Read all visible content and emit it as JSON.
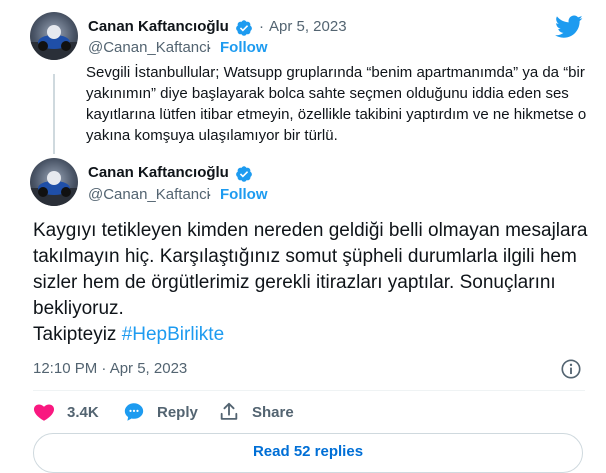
{
  "quoted_tweet": {
    "author_name": "Canan Kaftancıoğlu",
    "separator": "·",
    "date": "Apr 5, 2023",
    "handle": "@Canan_Kaftanci",
    "follow_separator": "·",
    "follow_label": "Follow",
    "text": "Sevgili İstanbullular; Watsupp gruplarında “benim apartmanımda” ya da “bir yakınımın” diye başlayarak bolca sahte seçmen olduğunu iddia eden ses kayıtlarına lütfen itibar etmeyin, özellikle takibini yaptırdım ve ne hikmetse o yakına komşuya ulaşılamıyor bir türlü."
  },
  "main_tweet": {
    "author_name": "Canan Kaftancıoğlu",
    "handle": "@Canan_Kaftanci",
    "follow_separator": "·",
    "follow_label": "Follow",
    "text": "Kaygıyı tetikleyen kimden nereden geldiği belli olmayan mesajlara takılmayın hiç. Karşılaştığınız somut şüpheli durumlarla ilgili hem sizler hem de örgütlerimiz gerekli itirazları yaptılar. Sonuçlarını bekliyoruz.",
    "trailing_text": "Takipteyiz ",
    "hashtag": "#HepBirlikte",
    "timestamp": "12:10 PM · Apr 5, 2023"
  },
  "actions": {
    "like_count": "3.4K",
    "reply_label": "Reply",
    "share_label": "Share"
  },
  "footer": {
    "read_replies_label": "Read 52 replies"
  },
  "icons": {
    "brand": "twitter-bird-icon",
    "verified": "verified-badge-icon",
    "info": "info-icon",
    "like": "heart-icon",
    "reply": "speech-bubble-icon",
    "share": "share-arrow-icon"
  },
  "colors": {
    "accent": "#1d9bf0",
    "like": "#f91880",
    "muted": "#536471",
    "link": "#006fd6"
  }
}
